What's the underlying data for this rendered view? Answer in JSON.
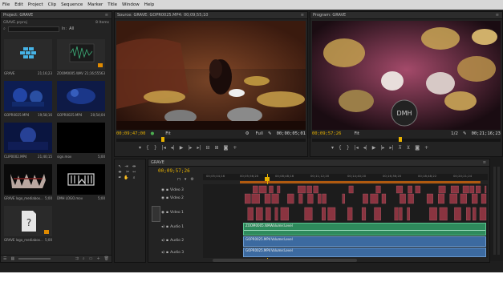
{
  "menubar": {
    "items": [
      "File",
      "Edit",
      "Project",
      "Clip",
      "Sequence",
      "Marker",
      "Title",
      "Window",
      "Help"
    ]
  },
  "project": {
    "tab": "Project: GRAVE",
    "name": "GRAVE.prproj",
    "items_count": "8 Items",
    "in_label": "In:",
    "in_value": "All",
    "items": [
      {
        "name": "GRAVE",
        "duration": "21;16;23",
        "kind": "sequence"
      },
      {
        "name": "ZOOM0005.WAV",
        "duration": "21;16;55563",
        "kind": "audio"
      },
      {
        "name": "GOPR0025.MP4",
        "duration": "19;58;16",
        "kind": "video"
      },
      {
        "name": "GOPR0025.MP4",
        "duration": "20;54;04",
        "kind": "video"
      },
      {
        "name": "CLIP0002.MP4",
        "duration": "21;40;15",
        "kind": "video"
      },
      {
        "name": "sign.mov",
        "duration": "5;00",
        "kind": "black"
      },
      {
        "name": "GRAVE logo_mediabox...",
        "duration": "5;00",
        "kind": "logo"
      },
      {
        "name": "DMH LOGO.mov",
        "duration": "5;00",
        "kind": "logo2"
      },
      {
        "name": "GRAVE logo_mediabox...",
        "duration": "5;00",
        "kind": "missing"
      }
    ]
  },
  "source": {
    "tab": "Source: GRAVE: GOPR0025.MP4: 00;09;55;10",
    "timecode_left": "00;09;47;00",
    "fit": "Fit",
    "quality": "Full",
    "timecode_right": "00;00;05;01"
  },
  "program": {
    "tab": "Program: GRAVE",
    "timecode_left": "00;09;57;26",
    "fit": "Fit",
    "quality": "1/2",
    "timecode_right": "00;21;16;23",
    "logo_text": "DMH"
  },
  "timeline": {
    "tab": "GRAVE",
    "timecode": "00;09;57;26",
    "ruler": [
      "00;05;04;16",
      "00;05;56;20",
      "00;08;48;16",
      "00;11;12;20",
      "00;14;40;20",
      "00;16;36;20",
      "00;18;48;22",
      "00;20;21;24"
    ],
    "video_tracks": [
      {
        "label": "Video 3",
        "id": "V3"
      },
      {
        "label": "Video 2",
        "id": "V2"
      },
      {
        "label": "Video 1",
        "id": "V1"
      }
    ],
    "audio_tracks": [
      {
        "label": "Audio 1",
        "id": "A1",
        "clip": "ZOOM0005.WAV",
        "level": "Volume:Level"
      },
      {
        "label": "Audio 2",
        "id": "A2",
        "clip": "GOPR0025.MP4",
        "level": "Volume:Level"
      },
      {
        "label": "Audio 3",
        "id": "A3",
        "clip": "GOPR0025.MP4",
        "level": "Volume:Level"
      }
    ]
  },
  "colors": {
    "accent": "#e7b100",
    "video_clip": "#8a3440",
    "audio_clip": "#2e8a5c",
    "audio_clip_blue": "#3c6aa0"
  }
}
